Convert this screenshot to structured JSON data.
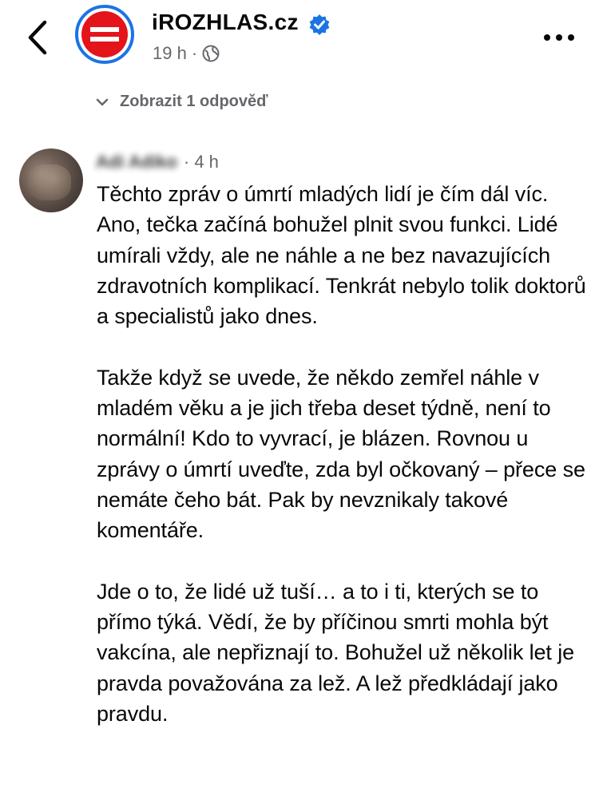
{
  "header": {
    "page_name": "iROZHLAS.cz",
    "time": "19 h",
    "separator": "·",
    "back_icon": "chevron-left-icon",
    "more_icon": "more-horizontal-icon",
    "verified_icon": "verified-badge-icon",
    "privacy_icon": "globe-icon"
  },
  "replies": {
    "label": "Zobrazit 1 odpověď",
    "icon": "chevron-down-icon"
  },
  "comment": {
    "author": "Adi Adiko",
    "time": "4 h",
    "separator": "·",
    "paragraphs": [
      "Těchto zpráv o úmrtí mladých lidí je čím dál víc. Ano, tečka začíná bohužel plnit svou funkci. Lidé umírali vždy, ale ne náhle a ne bez navazujících zdravotních komplikací. Tenkrát nebylo tolik doktorů a specialistů jako dnes.",
      "Takže když se uvede, že někdo zemřel náhle v mladém věku a je jich třeba deset týdně, není to normální! Kdo to vyvrací, je blázen. Rovnou u zprávy o úmrtí uveďte, zda byl očkovaný – přece se nemáte čeho bát. Pak by nevznikaly takové komentáře.",
      "Jde o to, že lidé už tuší… a to i ti, kterých se to přímo týká. Vědí, že by příčinou smrti mohla být vakcína, ale nepřiznají to. Bohužel už několik let je pravda považována za lež. A lež předkládají jako pravdu."
    ]
  },
  "colors": {
    "brand_red": "#e4141b",
    "facebook_blue": "#1b74e4",
    "secondary_text": "#65676b"
  }
}
